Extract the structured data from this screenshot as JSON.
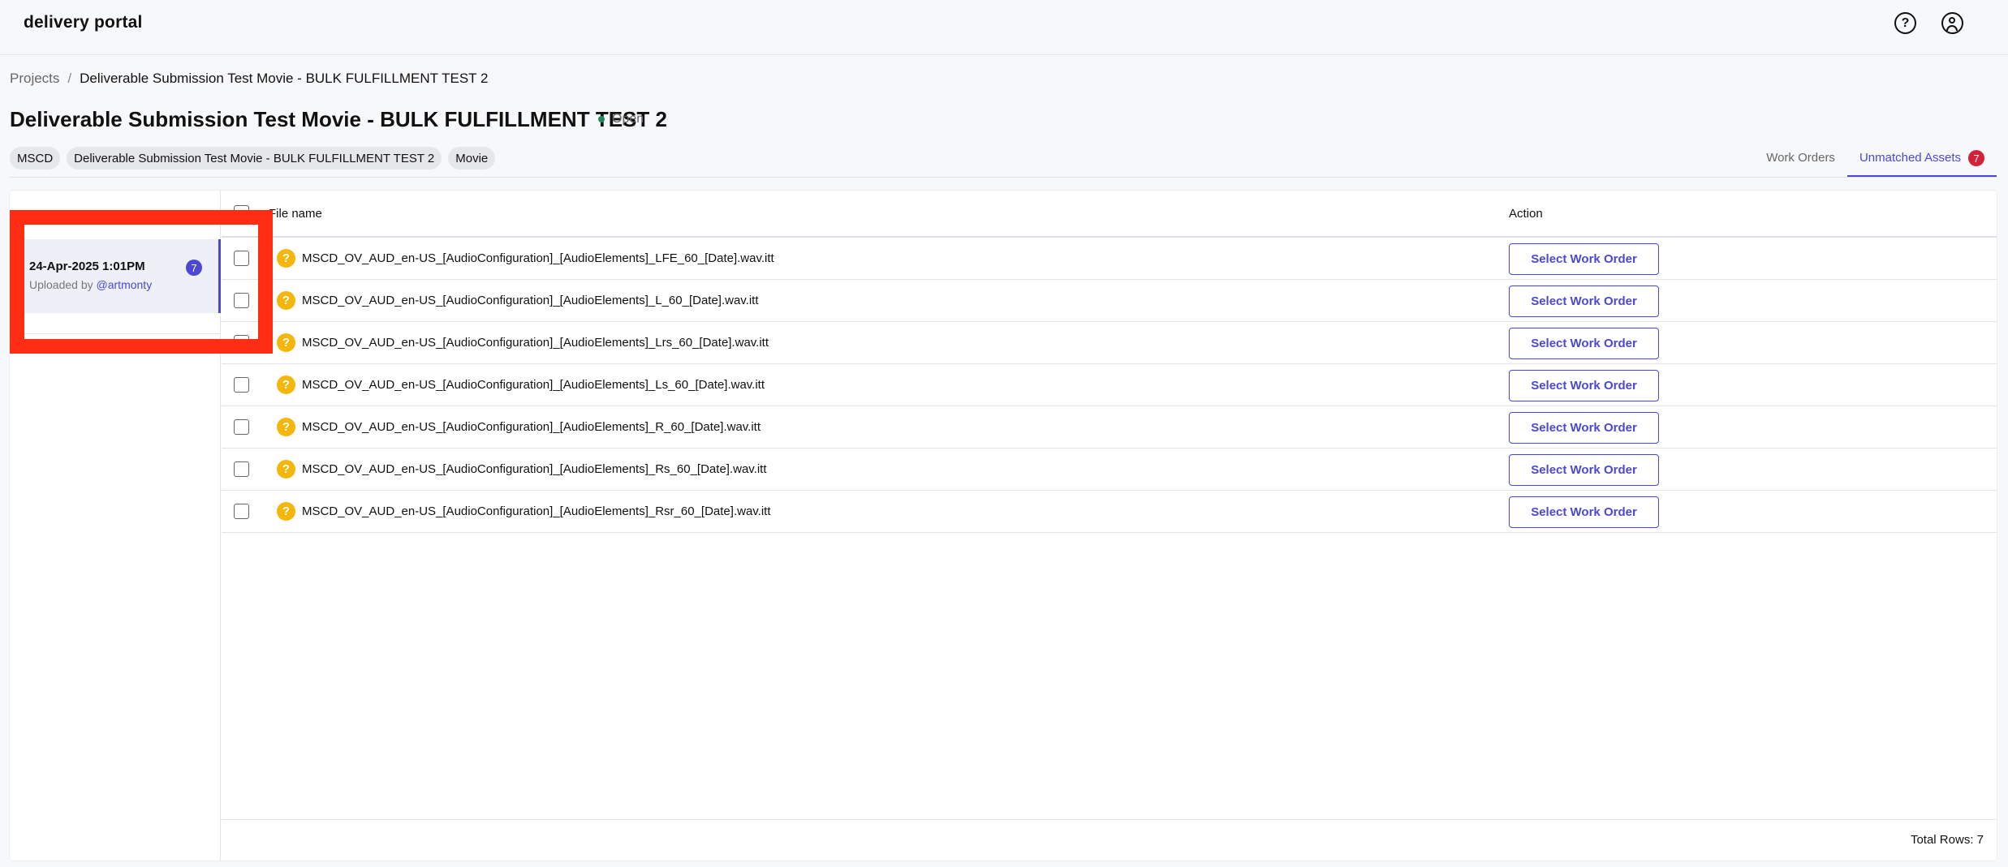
{
  "app": {
    "logo": "delivery portal",
    "help_icon": "help-circle-icon",
    "user_icon": "user-account-icon"
  },
  "breadcrumb": {
    "root": "Projects",
    "separator": "/",
    "current": "Deliverable Submission Test Movie - BULK FULFILLMENT TEST 2"
  },
  "project": {
    "title": "Deliverable Submission Test Movie - BULK FULFILLMENT TEST 2",
    "status": "Open",
    "status_color": "#1f8a5b",
    "tags": [
      "MSCD",
      "Deliverable Submission Test Movie - BULK FULFILLMENT TEST 2",
      "Movie"
    ]
  },
  "tabs": [
    {
      "label": "Work Orders",
      "active": false,
      "badge": ""
    },
    {
      "label": "Unmatched Assets",
      "active": true,
      "badge": "7"
    }
  ],
  "uploads": {
    "items": [
      {
        "date": "24-Apr-2025 1:01PM",
        "uploaded_by_prefix": "Uploaded by",
        "user": "@artmonty",
        "count": "7"
      }
    ]
  },
  "table": {
    "columns": {
      "file_name": "File name",
      "action": "Action"
    },
    "rows": [
      {
        "file_name": "MSCD_OV_AUD_en-US_[AudioConfiguration]_[AudioElements]_LFE_60_[Date].wav.itt",
        "action": "Select Work Order"
      },
      {
        "file_name": "MSCD_OV_AUD_en-US_[AudioConfiguration]_[AudioElements]_L_60_[Date].wav.itt",
        "action": "Select Work Order"
      },
      {
        "file_name": "MSCD_OV_AUD_en-US_[AudioConfiguration]_[AudioElements]_Lrs_60_[Date].wav.itt",
        "action": "Select Work Order"
      },
      {
        "file_name": "MSCD_OV_AUD_en-US_[AudioConfiguration]_[AudioElements]_Ls_60_[Date].wav.itt",
        "action": "Select Work Order"
      },
      {
        "file_name": "MSCD_OV_AUD_en-US_[AudioConfiguration]_[AudioElements]_R_60_[Date].wav.itt",
        "action": "Select Work Order"
      },
      {
        "file_name": "MSCD_OV_AUD_en-US_[AudioConfiguration]_[AudioElements]_Rs_60_[Date].wav.itt",
        "action": "Select Work Order"
      },
      {
        "file_name": "MSCD_OV_AUD_en-US_[AudioConfiguration]_[AudioElements]_Rsr_60_[Date].wav.itt",
        "action": "Select Work Order"
      }
    ],
    "total_rows": "Total Rows: 7"
  },
  "colors": {
    "accent": "#4b48d6",
    "badge_red": "#d32238",
    "warning": "#f5b60c",
    "redaction": "#ff2d14"
  }
}
